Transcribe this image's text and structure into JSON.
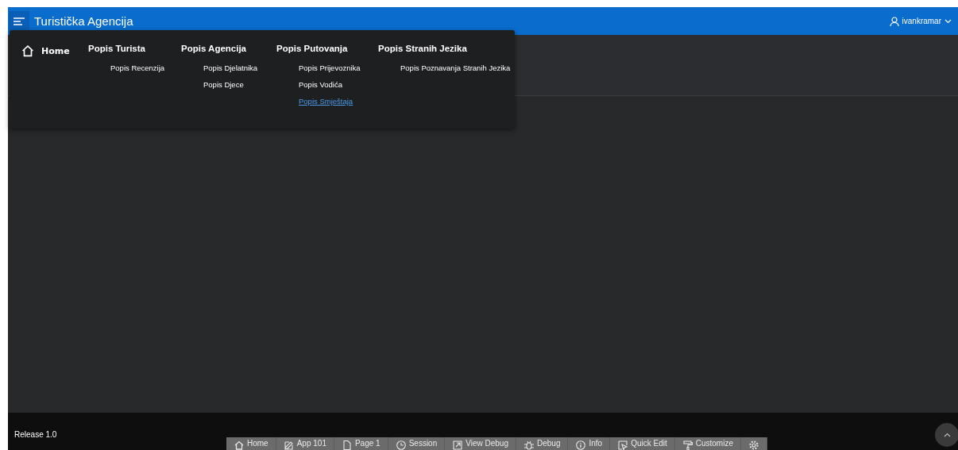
{
  "header": {
    "title": "Turistička Agencija",
    "user": "ivankramar"
  },
  "menu": [
    {
      "label": "Home",
      "kind": "home"
    },
    {
      "label": "Popis Turista",
      "kind": "group",
      "children": [
        {
          "label": "Popis Recenzija",
          "selected": false
        }
      ]
    },
    {
      "label": "Popis Agencija",
      "kind": "group",
      "children": [
        {
          "label": "Popis Djelatnika",
          "selected": false
        },
        {
          "label": "Popis Djece",
          "selected": false
        }
      ]
    },
    {
      "label": "Popis Putovanja",
      "kind": "group",
      "children": [
        {
          "label": "Popis Prijevoznika",
          "selected": false
        },
        {
          "label": "Popis Vodića",
          "selected": false
        },
        {
          "label": "Popis Smještaja",
          "selected": true
        }
      ]
    },
    {
      "label": "Popis Stranih Jezika",
      "kind": "group",
      "children": [
        {
          "label": "Popis Poznavanja Stranih Jezika",
          "selected": false
        }
      ]
    }
  ],
  "footer": {
    "release": "Release 1.0"
  },
  "dev_toolbar": [
    {
      "label": "Home",
      "kind": "home"
    },
    {
      "label": "App 101",
      "kind": "edit"
    },
    {
      "label": "Page 1",
      "kind": "page"
    },
    {
      "label": "Session",
      "kind": "clock"
    },
    {
      "label": "View Debug",
      "kind": "external"
    },
    {
      "label": "Debug",
      "kind": "bug"
    },
    {
      "label": "Info",
      "kind": "info"
    },
    {
      "label": "Quick Edit",
      "kind": "cursor"
    },
    {
      "label": "Customize",
      "kind": "roller"
    },
    {
      "kind": "gear"
    }
  ]
}
